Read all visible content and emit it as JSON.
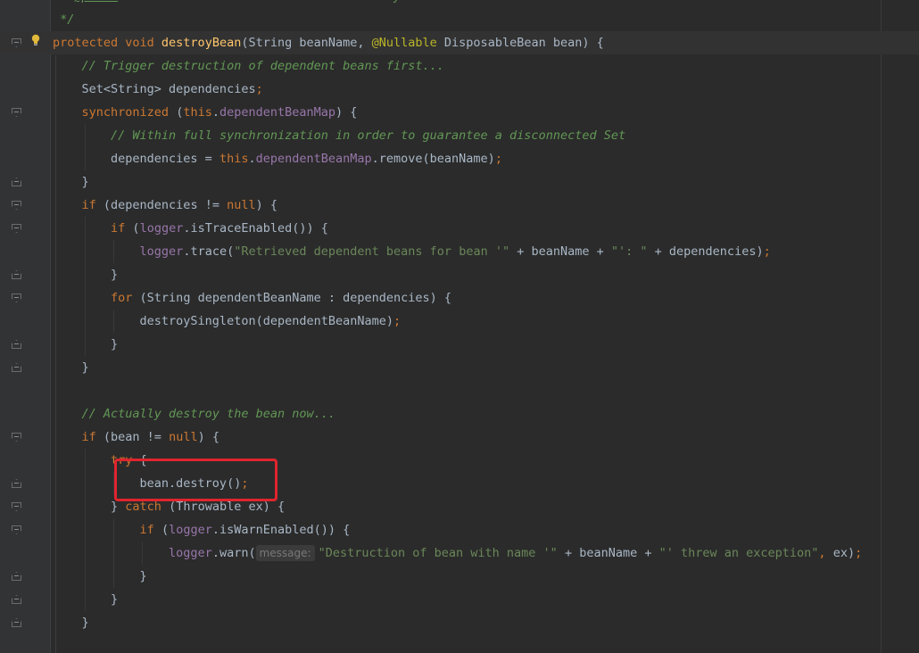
{
  "editor": {
    "lines": [
      {
        "name": "line-doc-param",
        "tokens": [
          {
            "t": "doc",
            "v": " * "
          },
          {
            "t": "doc-tag",
            "v": "@param"
          },
          {
            "t": "doc",
            "v": " bean      the bean instance to destroy"
          }
        ]
      },
      {
        "name": "line-doc-end",
        "tokens": [
          {
            "t": "doc",
            "v": " */"
          }
        ]
      },
      {
        "name": "line-method-signature",
        "tokens": [
          {
            "t": "kw",
            "v": "protected void "
          },
          {
            "t": "fn",
            "v": "destroyBean"
          },
          {
            "t": "",
            "v": "(String beanName, "
          },
          {
            "t": "ann",
            "v": "@Nullable "
          },
          {
            "t": "",
            "v": "DisposableBean bean) {"
          }
        ]
      },
      {
        "name": "line-comment-trigger",
        "tokens": [
          {
            "t": "",
            "v": "    "
          },
          {
            "t": "cm",
            "v": "// Trigger destruction of dependent beans first..."
          }
        ]
      },
      {
        "name": "line-set-dependencies",
        "tokens": [
          {
            "t": "",
            "v": "    Set<String> dependencies"
          },
          {
            "t": "punct",
            "v": ";"
          }
        ]
      },
      {
        "name": "line-synchronized",
        "tokens": [
          {
            "t": "",
            "v": "    "
          },
          {
            "t": "kw",
            "v": "synchronized "
          },
          {
            "t": "",
            "v": "("
          },
          {
            "t": "kw",
            "v": "this"
          },
          {
            "t": "",
            "v": "."
          },
          {
            "t": "field",
            "v": "dependentBeanMap"
          },
          {
            "t": "",
            "v": ") {"
          }
        ]
      },
      {
        "name": "line-comment-sync",
        "tokens": [
          {
            "t": "",
            "v": "        "
          },
          {
            "t": "cm",
            "v": "// Within full synchronization in order to guarantee a disconnected Set"
          }
        ]
      },
      {
        "name": "line-remove",
        "tokens": [
          {
            "t": "",
            "v": "        dependencies = "
          },
          {
            "t": "kw",
            "v": "this"
          },
          {
            "t": "",
            "v": "."
          },
          {
            "t": "field",
            "v": "dependentBeanMap"
          },
          {
            "t": "",
            "v": ".remove(beanName)"
          },
          {
            "t": "punct",
            "v": ";"
          }
        ]
      },
      {
        "name": "line-close-sync",
        "tokens": [
          {
            "t": "",
            "v": "    }"
          }
        ]
      },
      {
        "name": "line-if-dependencies",
        "tokens": [
          {
            "t": "",
            "v": "    "
          },
          {
            "t": "kw",
            "v": "if "
          },
          {
            "t": "",
            "v": "(dependencies != "
          },
          {
            "t": "kw",
            "v": "null"
          },
          {
            "t": "",
            "v": ") {"
          }
        ]
      },
      {
        "name": "line-if-trace",
        "tokens": [
          {
            "t": "",
            "v": "        "
          },
          {
            "t": "kw",
            "v": "if "
          },
          {
            "t": "",
            "v": "("
          },
          {
            "t": "field",
            "v": "logger"
          },
          {
            "t": "",
            "v": ".isTraceEnabled()) {"
          }
        ]
      },
      {
        "name": "line-logger-trace",
        "tokens": [
          {
            "t": "",
            "v": "            "
          },
          {
            "t": "field",
            "v": "logger"
          },
          {
            "t": "",
            "v": ".trace("
          },
          {
            "t": "str",
            "v": "\"Retrieved dependent beans for bean '\""
          },
          {
            "t": "",
            "v": " + beanName + "
          },
          {
            "t": "str",
            "v": "\"': \""
          },
          {
            "t": "",
            "v": " + dependencies)"
          },
          {
            "t": "punct",
            "v": ";"
          }
        ]
      },
      {
        "name": "line-close-trace",
        "tokens": [
          {
            "t": "",
            "v": "        }"
          }
        ]
      },
      {
        "name": "line-for",
        "tokens": [
          {
            "t": "",
            "v": "        "
          },
          {
            "t": "kw",
            "v": "for "
          },
          {
            "t": "",
            "v": "(String dependentBeanName : dependencies) {"
          }
        ]
      },
      {
        "name": "line-destroy-singleton",
        "tokens": [
          {
            "t": "",
            "v": "            destroySingleton(dependentBeanName)"
          },
          {
            "t": "punct",
            "v": ";"
          }
        ]
      },
      {
        "name": "line-close-for",
        "tokens": [
          {
            "t": "",
            "v": "        }"
          }
        ]
      },
      {
        "name": "line-close-if-deps",
        "tokens": [
          {
            "t": "",
            "v": "    }"
          }
        ]
      },
      {
        "name": "line-blank",
        "tokens": [
          {
            "t": "",
            "v": ""
          }
        ]
      },
      {
        "name": "line-comment-destroy",
        "tokens": [
          {
            "t": "",
            "v": "    "
          },
          {
            "t": "cm",
            "v": "// Actually destroy the bean now..."
          }
        ]
      },
      {
        "name": "line-if-bean",
        "tokens": [
          {
            "t": "",
            "v": "    "
          },
          {
            "t": "kw",
            "v": "if "
          },
          {
            "t": "",
            "v": "(bean != "
          },
          {
            "t": "kw",
            "v": "null"
          },
          {
            "t": "",
            "v": ") {"
          }
        ]
      },
      {
        "name": "line-try",
        "tokens": [
          {
            "t": "",
            "v": "        "
          },
          {
            "t": "kw",
            "v": "try "
          },
          {
            "t": "",
            "v": "{"
          }
        ]
      },
      {
        "name": "line-bean-destroy",
        "tokens": [
          {
            "t": "",
            "v": "            bean.destroy()"
          },
          {
            "t": "punct",
            "v": ";"
          }
        ]
      },
      {
        "name": "line-catch",
        "tokens": [
          {
            "t": "",
            "v": "        } "
          },
          {
            "t": "kw",
            "v": "catch "
          },
          {
            "t": "",
            "v": "(Throwable ex) {"
          }
        ]
      },
      {
        "name": "line-if-warn",
        "tokens": [
          {
            "t": "",
            "v": "            "
          },
          {
            "t": "kw",
            "v": "if "
          },
          {
            "t": "",
            "v": "("
          },
          {
            "t": "field",
            "v": "logger"
          },
          {
            "t": "",
            "v": ".isWarnEnabled()) {"
          }
        ]
      },
      {
        "name": "line-logger-warn",
        "tokens": [
          {
            "t": "",
            "v": "                "
          },
          {
            "t": "field",
            "v": "logger"
          },
          {
            "t": "",
            "v": ".warn("
          },
          {
            "t": "hint",
            "v": "message:"
          },
          {
            "t": "str",
            "v": "\"Destruction of bean with name '\""
          },
          {
            "t": "",
            "v": " + beanName + "
          },
          {
            "t": "str",
            "v": "\"' threw an exception\""
          },
          {
            "t": "punct",
            "v": ", "
          },
          {
            "t": "",
            "v": "ex)"
          },
          {
            "t": "punct",
            "v": ";"
          }
        ]
      },
      {
        "name": "line-close-if-warn",
        "tokens": [
          {
            "t": "",
            "v": "            }"
          }
        ]
      },
      {
        "name": "line-close-catch",
        "tokens": [
          {
            "t": "",
            "v": "        }"
          }
        ]
      },
      {
        "name": "line-close-if-bean",
        "tokens": [
          {
            "t": "",
            "v": "    }"
          }
        ]
      }
    ]
  },
  "colors": {
    "background": "#2b2b2b",
    "gutter": "#313335",
    "keyword": "#cc7832",
    "method": "#ffc66d",
    "field": "#9876aa",
    "string": "#6a8759",
    "comment": "#629755",
    "annotation": "#bbb529",
    "highlight_box": "#e0242e"
  },
  "icons": {
    "intention": "lightbulb-icon",
    "fold": "fold-marker-icon"
  }
}
